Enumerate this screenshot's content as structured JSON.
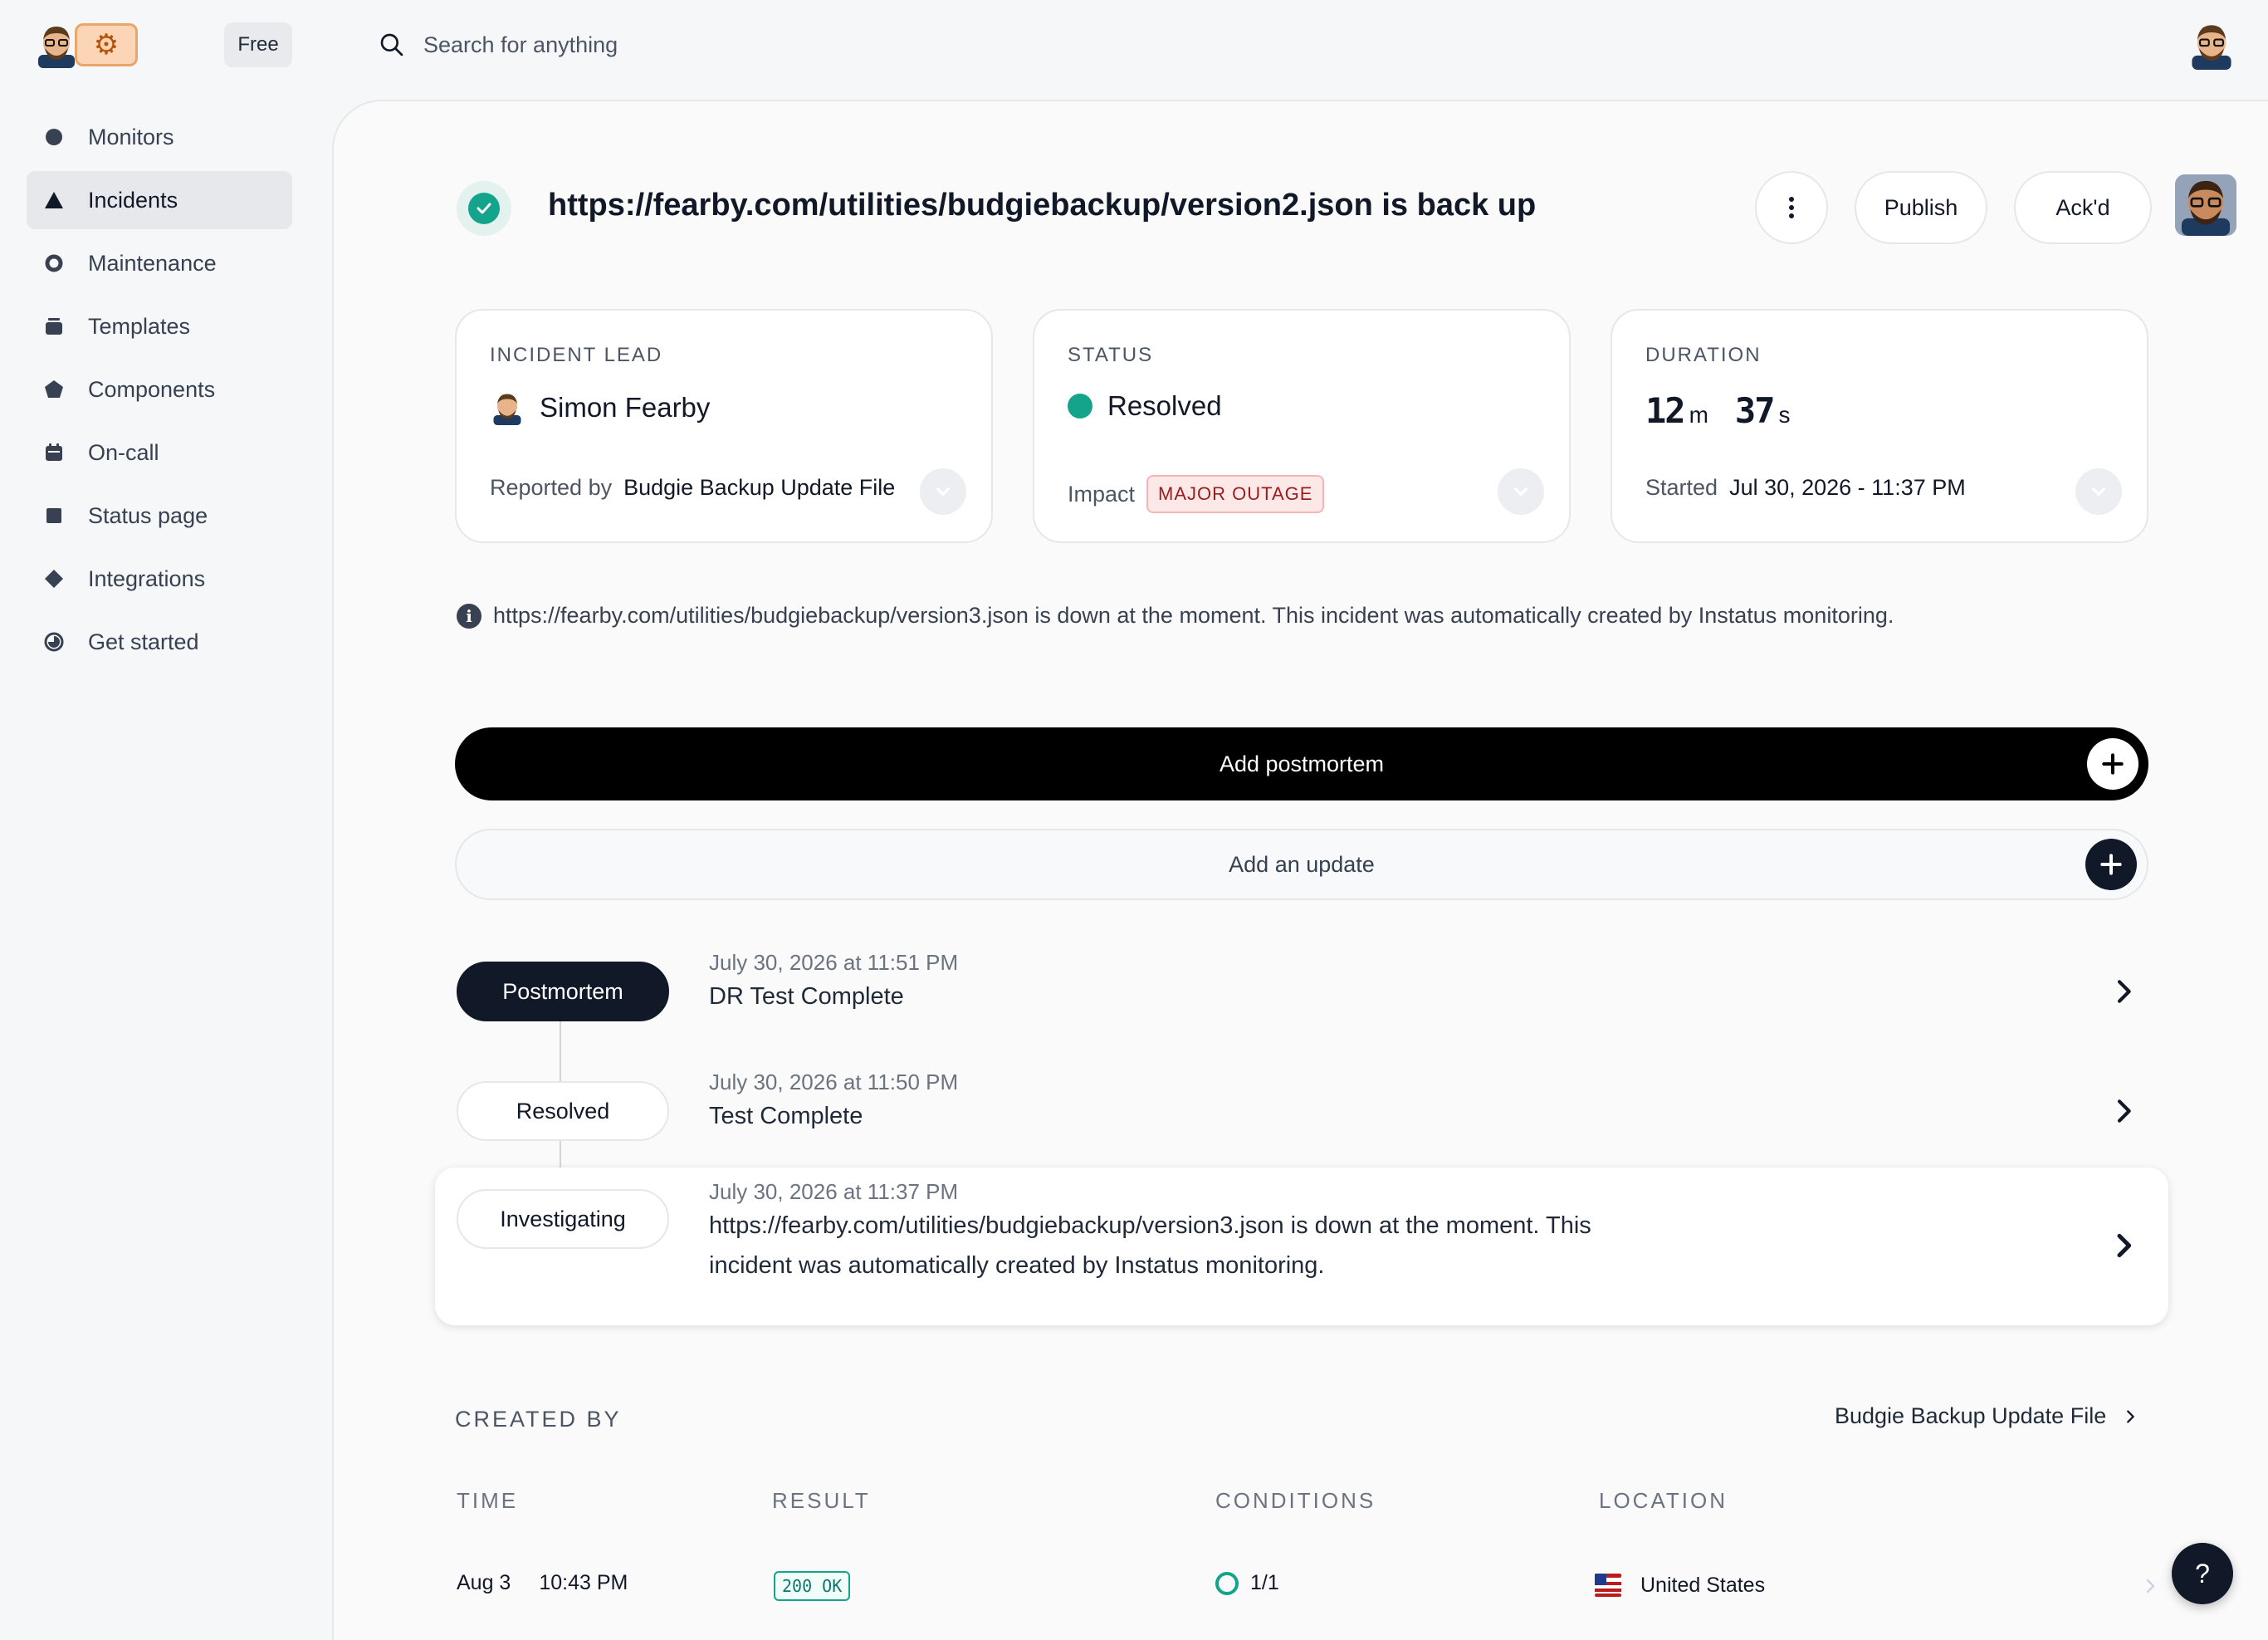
{
  "app": {
    "plan_badge": "Free",
    "search_placeholder": "Search for anything"
  },
  "sidebar": {
    "items": [
      {
        "label": "Monitors",
        "icon": "circle-icon"
      },
      {
        "label": "Incidents",
        "icon": "triangle-icon",
        "active": true
      },
      {
        "label": "Maintenance",
        "icon": "ring-icon"
      },
      {
        "label": "Templates",
        "icon": "stack-icon"
      },
      {
        "label": "Components",
        "icon": "pentagon-icon"
      },
      {
        "label": "On-call",
        "icon": "calendar-icon"
      },
      {
        "label": "Status page",
        "icon": "square-icon"
      },
      {
        "label": "Integrations",
        "icon": "diamond-icon"
      },
      {
        "label": "Get started",
        "icon": "progress-circle-icon"
      }
    ]
  },
  "incident": {
    "title": "https://fearby.com/utilities/budgiebackup/version2.json is back up",
    "actions": {
      "publish": "Publish",
      "ack": "Ack'd"
    },
    "lead": {
      "label": "INCIDENT LEAD",
      "name": "Simon Fearby",
      "reported_prefix": "Reported by",
      "reported_by": "Budgie Backup Update File"
    },
    "status": {
      "label": "STATUS",
      "value": "Resolved",
      "impact_label": "Impact",
      "impact": "MAJOR OUTAGE"
    },
    "duration": {
      "label": "DURATION",
      "minutes": "12",
      "minutes_unit": "m",
      "seconds": "37",
      "seconds_unit": "s",
      "started_label": "Started",
      "started": "Jul 30, 2026 - 11:37 PM"
    },
    "description": "https://fearby.com/utilities/budgiebackup/version3.json is down at the moment. This incident was automatically created by Instatus monitoring.",
    "add_postmortem": "Add postmortem",
    "add_update": "Add an update"
  },
  "timeline": [
    {
      "status": "Postmortem",
      "time": "July 30, 2026 at 11:51 PM",
      "text": "DR Test Complete"
    },
    {
      "status": "Resolved",
      "time": "July 30, 2026 at 11:50 PM",
      "text": "Test Complete"
    },
    {
      "status": "Investigating",
      "time": "July 30, 2026 at 11:37 PM",
      "text": "https://fearby.com/utilities/budgiebackup/version3.json is down at the moment. This incident was automatically created by Instatus monitoring."
    }
  ],
  "created_by": {
    "label": "CREATED BY",
    "monitor": "Budgie Backup Update File",
    "columns": [
      "TIME",
      "RESULT",
      "CONDITIONS",
      "LOCATION"
    ],
    "row": {
      "date": "Aug 3",
      "time": "10:43 PM",
      "result": "200 OK",
      "conditions": "1/1",
      "location": "United States"
    }
  },
  "help_label": "?",
  "colors": {
    "accent_green": "#14a38b",
    "outage_red": "#9b1c1c",
    "dark": "#111827"
  }
}
